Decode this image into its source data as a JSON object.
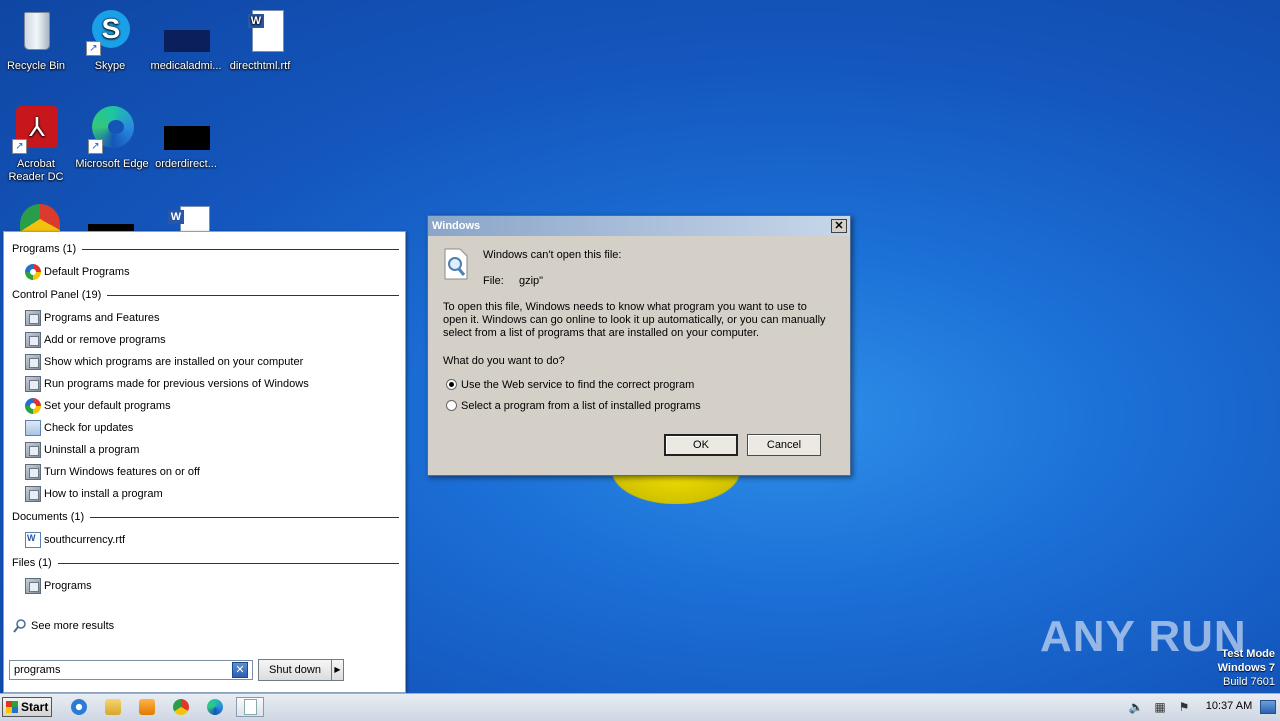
{
  "desktop": {
    "icons": [
      {
        "label": "Recycle Bin",
        "icon": "recycle-bin-icon"
      },
      {
        "label": "Skype",
        "icon": "skype-icon"
      },
      {
        "label": "medicaladmi...",
        "icon": "black-file-icon"
      },
      {
        "label": "directhtml.rtf",
        "icon": "word-document-icon"
      },
      {
        "label": "Acrobat Reader DC",
        "icon": "acrobat-icon"
      },
      {
        "label": "Microsoft Edge",
        "icon": "edge-icon"
      },
      {
        "label": "orderdirect...",
        "icon": "black-file-icon"
      }
    ]
  },
  "start_menu": {
    "sections": [
      {
        "title": "Programs (1)",
        "items": [
          "Default Programs"
        ]
      },
      {
        "title": "Control Panel (19)",
        "items": [
          "Programs and Features",
          "Add or remove programs",
          "Show which programs are installed on your computer",
          "Run programs made for previous versions of Windows",
          "Set your default programs",
          "Check for updates",
          "Uninstall a program",
          "Turn Windows features on or off",
          "How to install a program"
        ]
      },
      {
        "title": "Documents (1)",
        "items": [
          "southcurrency.rtf"
        ]
      },
      {
        "title": "Files (1)",
        "items": [
          "Programs"
        ]
      }
    ],
    "see_more": "See more results",
    "search_value": "programs",
    "shutdown_label": "Shut down"
  },
  "dialog": {
    "title": "Windows",
    "heading": "Windows can't open this file:",
    "file_label": "File:",
    "file_name": "gzip\"",
    "description_lines": [
      "To open this file, Windows needs to know what program you want to use to",
      "open it. Windows can go online to look it up automatically, or you can manually",
      "select from a list of programs that are installed on your computer."
    ],
    "question": "What do you want to do?",
    "options": [
      {
        "label": "Use the Web service to find the correct program",
        "selected": true
      },
      {
        "label": "Select a program from a list of installed programs",
        "selected": false
      }
    ],
    "ok_label": "OK",
    "cancel_label": "Cancel"
  },
  "taskbar": {
    "start_label": "Start",
    "pinned": [
      "internet-explorer-icon",
      "file-explorer-icon",
      "media-player-icon",
      "chrome-icon",
      "edge-icon",
      "notepad-icon"
    ],
    "clock": "10:37 AM"
  },
  "watermark": {
    "line1": "Test Mode",
    "line2": "Windows 7",
    "line3": "Build 7601",
    "brand": "ANY RUN"
  }
}
